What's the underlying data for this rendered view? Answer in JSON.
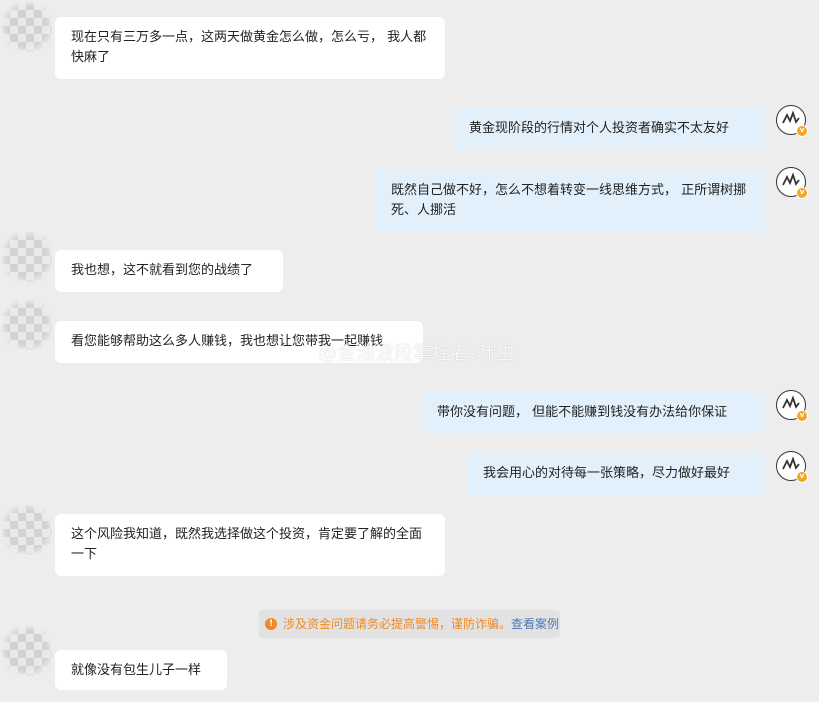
{
  "messages": [
    {
      "side": "left",
      "text": "现在只有三万多一点，这两天做黄金怎么做，怎么亏， 我人都快麻了"
    },
    {
      "side": "right",
      "text": "黄金现阶段的行情对个人投资者确实不太友好"
    },
    {
      "side": "right",
      "text": "既然自己做不好，怎么不想着转变一线思维方式， 正所谓树挪死、人挪活"
    },
    {
      "side": "left",
      "text": "我也想，这不就看到您的战绩了"
    },
    {
      "side": "left",
      "text": "看您能够帮助这么多人赚钱，我也想让您带我一起赚钱"
    },
    {
      "side": "right",
      "text": "带你没有问题， 但能不能赚到钱没有办法给你保证"
    },
    {
      "side": "right",
      "text": "我会用心的对待每一张策略，尽力做好最好"
    },
    {
      "side": "left",
      "text": "这个风险我知道，既然我选择做这个投资，肯定要了解的全面一下"
    },
    {
      "side": "left",
      "text": "就像没有包生儿子一样"
    }
  ],
  "notice": {
    "text": "涉及资金问题请务必提高警惕，谨防诈骗。",
    "link": "查看案例"
  },
  "watermark": "@金油波段掌控者-叶生",
  "colors": {
    "background": "#ededed",
    "bubble_left": "#ffffff",
    "bubble_right": "#e2f0fb",
    "notice_text": "#f08a24",
    "notice_link": "#4a7ab8",
    "badge": "#f5a623"
  }
}
